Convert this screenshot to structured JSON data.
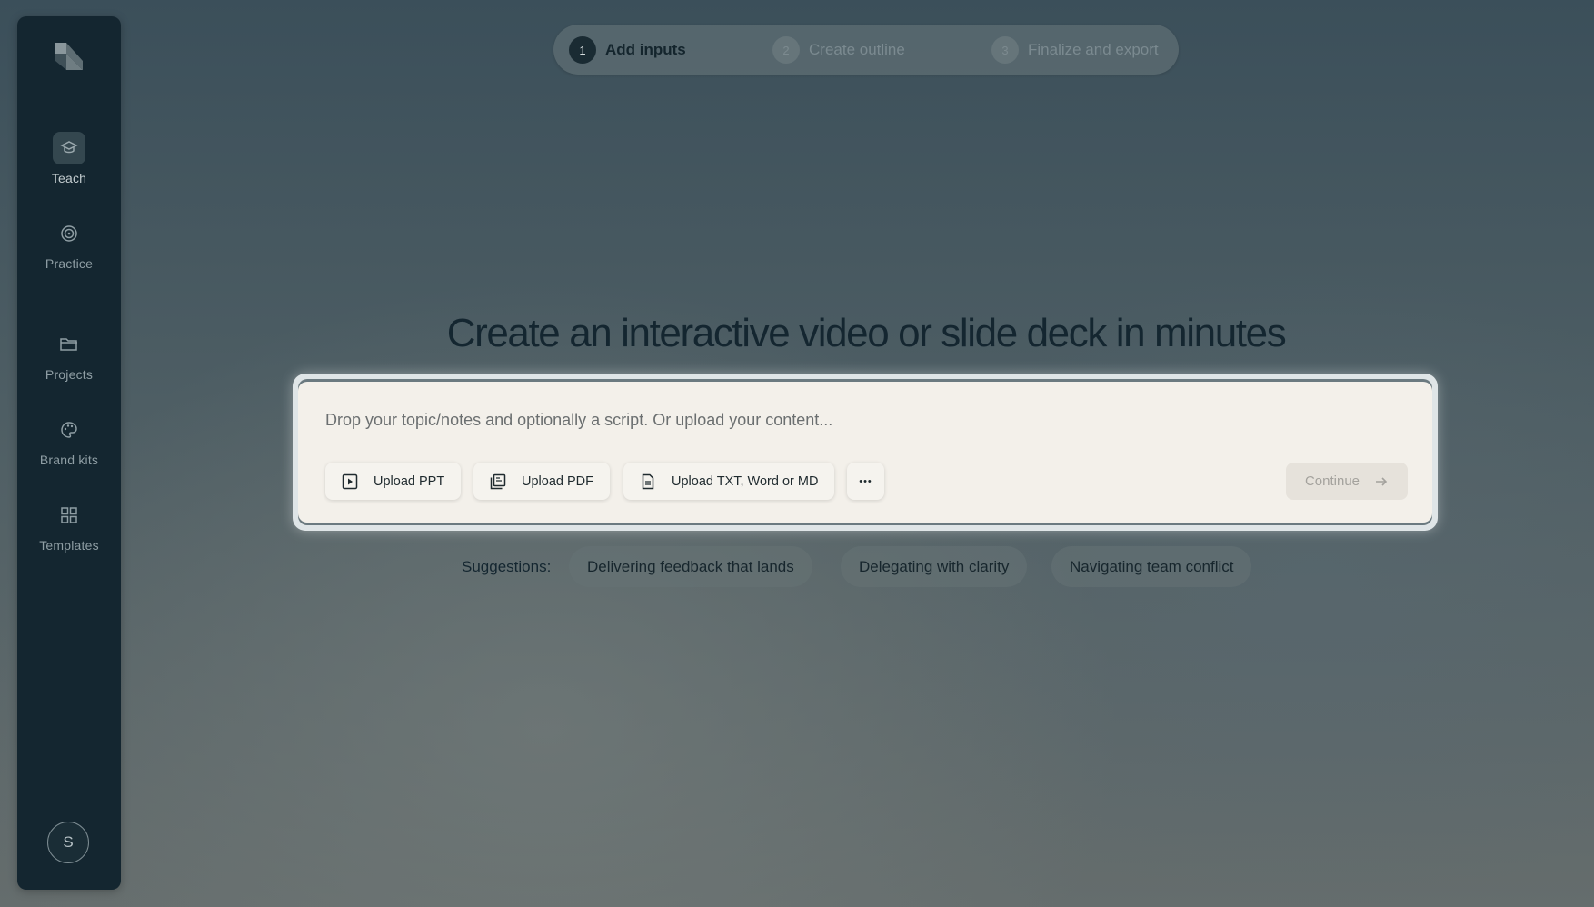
{
  "sidebar": {
    "items": [
      {
        "label": "Teach",
        "icon": "graduation-cap-icon",
        "active": true
      },
      {
        "label": "Practice",
        "icon": "target-icon",
        "active": false
      },
      {
        "label": "Projects",
        "icon": "folder-icon",
        "active": false
      },
      {
        "label": "Brand kits",
        "icon": "palette-icon",
        "active": false
      },
      {
        "label": "Templates",
        "icon": "grid-icon",
        "active": false
      }
    ],
    "avatar_initial": "S"
  },
  "stepper": {
    "steps": [
      {
        "number": "1",
        "label": "Add inputs",
        "active": true
      },
      {
        "number": "2",
        "label": "Create outline",
        "active": false
      },
      {
        "number": "3",
        "label": "Finalize and export",
        "active": false
      }
    ]
  },
  "main": {
    "headline": "Create an interactive video or slide deck in minutes",
    "input": {
      "placeholder": "Drop your topic/notes and optionally a script. Or upload your content..."
    },
    "tools": {
      "upload_ppt": "Upload PPT",
      "upload_pdf": "Upload PDF",
      "upload_txt": "Upload TXT, Word or MD",
      "more": "•••"
    },
    "continue_label": "Continue",
    "suggestions_label": "Suggestions:",
    "suggestions": [
      "Delivering feedback that lands",
      "Delegating with clarity",
      "Navigating team conflict"
    ]
  },
  "colors": {
    "sidebar_bg": "#142630",
    "card_bg": "#f3f0ea",
    "text_dark": "#142630"
  }
}
